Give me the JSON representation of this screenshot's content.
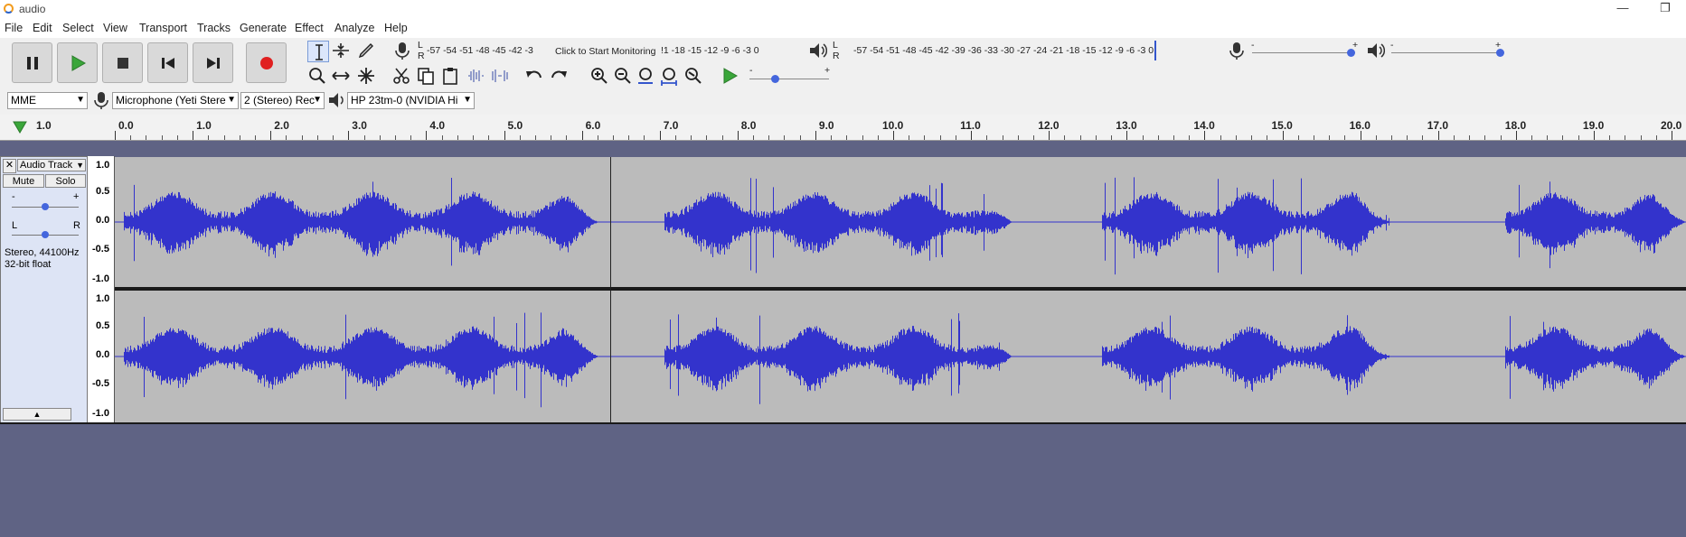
{
  "window": {
    "title": "audio"
  },
  "menu": [
    "File",
    "Edit",
    "Select",
    "View",
    "Transport",
    "Tracks",
    "Generate",
    "Effect",
    "Analyze",
    "Help"
  ],
  "record_meter": {
    "lr": [
      "L",
      "R"
    ],
    "scale": "-57 -54 -51 -48 -45 -42 -3",
    "monitor_label": "Click to Start Monitoring",
    "scale_right": "!1 -18 -15 -12 -9 -6 -3 0"
  },
  "playback_meter": {
    "lr": [
      "L",
      "R"
    ],
    "scale": "-57 -54 -51 -48 -45 -42 -39 -36 -33 -30 -27 -24 -21 -18 -15 -12 -9 -6 -3 0"
  },
  "sliders": {
    "minus": "-",
    "plus": "+"
  },
  "devices": {
    "host": "MME",
    "input": "Microphone (Yeti Stere",
    "channels": "2 (Stereo) Rec",
    "output": "HP 23tm-0 (NVIDIA Hi"
  },
  "ruler": {
    "start_label": "1.0",
    "ticks": [
      "0.0",
      "1.0",
      "2.0",
      "3.0",
      "4.0",
      "5.0",
      "6.0",
      "7.0",
      "8.0",
      "9.0",
      "10.0",
      "11.0",
      "12.0",
      "13.0",
      "14.0",
      "15.0",
      "16.0",
      "17.0",
      "18.0",
      "19.0",
      "20.0"
    ]
  },
  "track": {
    "name": "Audio Track",
    "mute": "Mute",
    "solo": "Solo",
    "gain_minus": "-",
    "gain_plus": "+",
    "pan_left": "L",
    "pan_right": "R",
    "info_line1": "Stereo, 44100Hz",
    "info_line2": "32-bit float",
    "scale": [
      "1.0",
      "0.5",
      "0.0",
      "-0.5",
      "-1.0"
    ]
  },
  "colors": {
    "waveform": "#3333cc",
    "wave_bg": "#bbbbbb",
    "track_panel": "#dde4f5",
    "empty": "#5f6384",
    "record": "#e02020",
    "play": "#3aa63a"
  }
}
